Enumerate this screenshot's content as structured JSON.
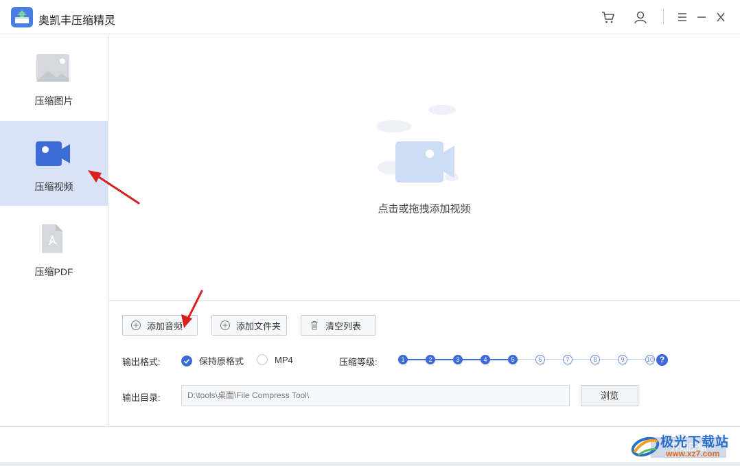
{
  "app": {
    "title": "奥凯丰压缩精灵"
  },
  "sidebar": {
    "items": [
      {
        "label": "压缩图片",
        "icon": "image-icon"
      },
      {
        "label": "压缩视频",
        "icon": "video-icon",
        "active": true
      },
      {
        "label": "压缩PDF",
        "icon": "pdf-icon"
      }
    ]
  },
  "drop": {
    "hint": "点击或拖拽添加视频"
  },
  "toolbar": {
    "add_audio": "添加音频",
    "add_folder": "添加文件夹",
    "clear_list": "清空列表"
  },
  "output_format": {
    "label": "输出格式:",
    "options": [
      {
        "label": "保持原格式",
        "checked": true
      },
      {
        "label": "MP4",
        "checked": false
      }
    ]
  },
  "compression_level": {
    "label": "压缩等级:",
    "levels": [
      "1",
      "2",
      "3",
      "4",
      "5",
      "6",
      "7",
      "8",
      "9",
      "10"
    ],
    "selected": 5,
    "help": "?"
  },
  "output_dir": {
    "label": "输出目录:",
    "value": "D:\\tools\\桌面\\File Compress Tool\\",
    "browse": "浏览"
  },
  "footer": {
    "start": "开始压缩"
  },
  "watermark": {
    "name": "极光下载站",
    "url": "www.xz7.com"
  },
  "colors": {
    "accent": "#3d6bd8",
    "active_bg": "#d9e3f7",
    "arrow": "#d9201c"
  }
}
